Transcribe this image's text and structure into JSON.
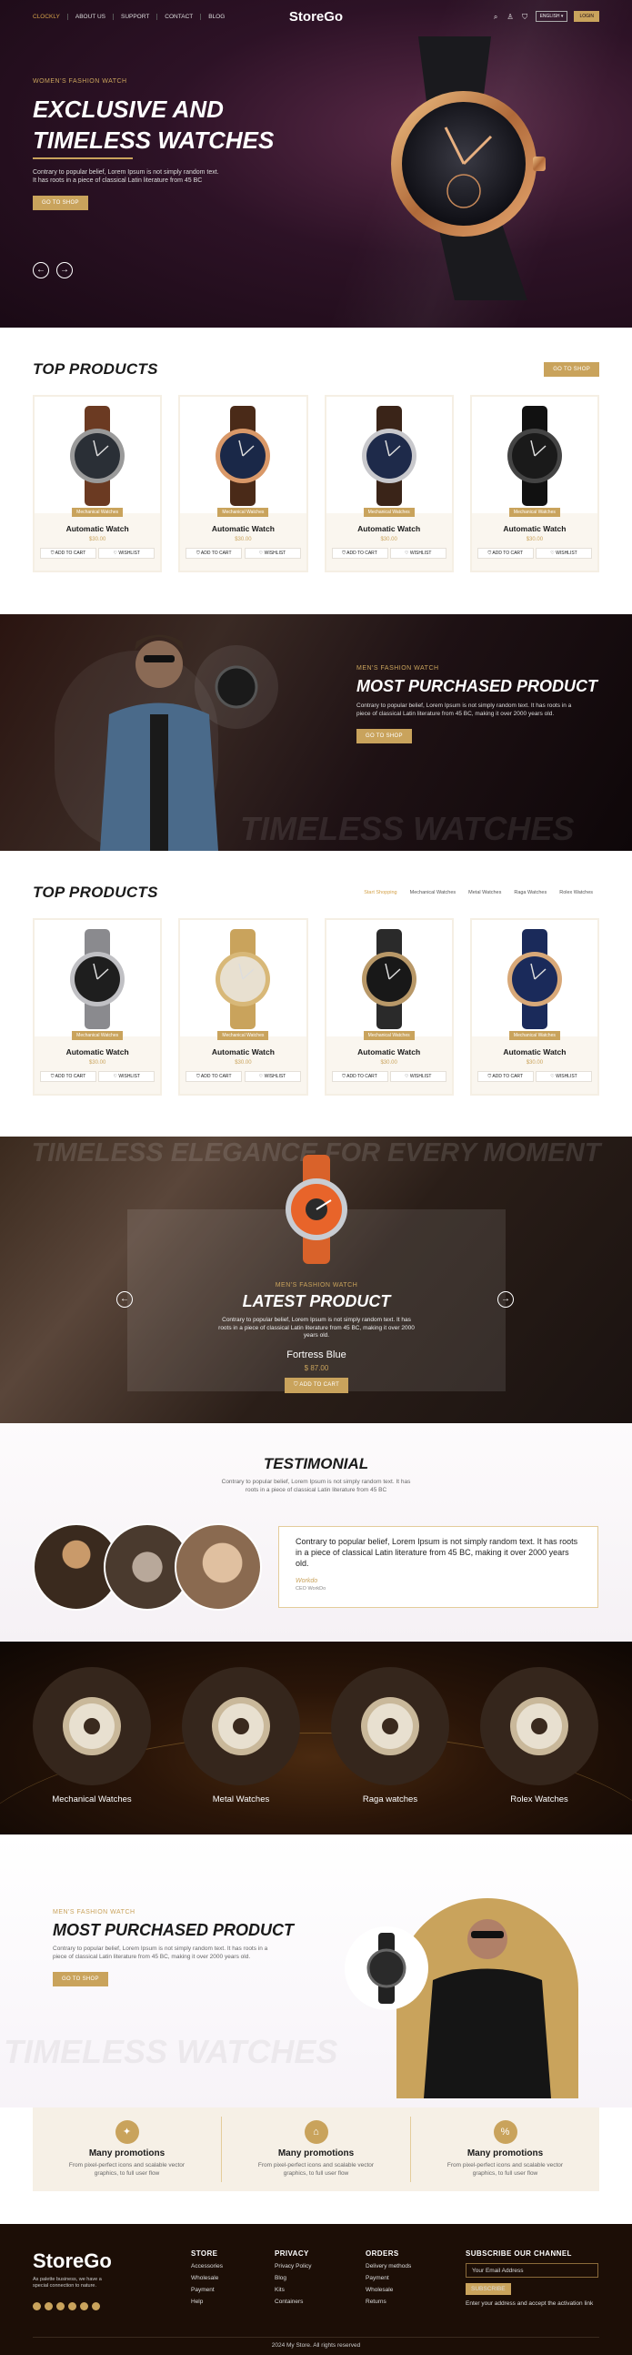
{
  "nav": {
    "links": [
      "CLOCKLY",
      "ABOUT US",
      "SUPPORT",
      "CONTACT",
      "BLOG"
    ],
    "brand": "StoreGo",
    "language": "ENGLISH ▾",
    "login": "LOGIN"
  },
  "hero": {
    "eyebrow": "WOMEN'S FASHION WATCH",
    "title_line1": "EXCLUSIVE AND",
    "title_line2": "TIMELESS WATCHES",
    "description": "Contrary to popular belief, Lorem Ipsum is not simply random text. It has roots in a piece of classical Latin literature from 45 BC",
    "button": "GO TO SHOP"
  },
  "top_products_1": {
    "title": "TOP PRODUCTS",
    "button": "GO TO SHOP",
    "products": [
      {
        "badge": "Mechanical Watches",
        "name": "Automatic Watch",
        "price": "$30.00",
        "add": "ADD TO CART",
        "wish": "WISHLIST"
      },
      {
        "badge": "Mechanical Watches",
        "name": "Automatic Watch",
        "price": "$30.00",
        "add": "ADD TO CART",
        "wish": "WISHLIST"
      },
      {
        "badge": "Mechanical Watches",
        "name": "Automatic Watch",
        "price": "$30.00",
        "add": "ADD TO CART",
        "wish": "WISHLIST"
      },
      {
        "badge": "Mechanical Watches",
        "name": "Automatic Watch",
        "price": "$30.00",
        "add": "ADD TO CART",
        "wish": "WISHLIST"
      }
    ]
  },
  "most_purchased_dark": {
    "eyebrow": "MEN'S FASHION WATCH",
    "title": "MOST PURCHASED PRODUCT",
    "description": "Contrary to popular belief, Lorem Ipsum is not simply random text. It has roots in a piece of classical Latin literature from 45 BC, making it over 2000 years old.",
    "button": "GO TO SHOP",
    "watermark": "TIMELESS WATCHES"
  },
  "top_products_2": {
    "title": "TOP PRODUCTS",
    "tabs": [
      "Start Shopping",
      "Mechanical Watches",
      "Metal Watches",
      "Raga Watches",
      "Rolex Watches"
    ],
    "products": [
      {
        "badge": "Mechanical Watches",
        "name": "Automatic Watch",
        "price": "$30.00",
        "add": "ADD TO CART",
        "wish": "WISHLIST"
      },
      {
        "badge": "Mechanical Watches",
        "name": "Automatic Watch",
        "price": "$30.00",
        "add": "ADD TO CART",
        "wish": "WISHLIST"
      },
      {
        "badge": "Mechanical Watches",
        "name": "Automatic Watch",
        "price": "$30.00",
        "add": "ADD TO CART",
        "wish": "WISHLIST"
      },
      {
        "badge": "Mechanical Watches",
        "name": "Automatic Watch",
        "price": "$30.00",
        "add": "ADD TO CART",
        "wish": "WISHLIST"
      }
    ]
  },
  "latest": {
    "watermark": "TIMELESS ELEGANCE FOR EVERY MOMENT",
    "eyebrow": "MEN'S FASHION WATCH",
    "title": "LATEST PRODUCT",
    "description": "Contrary to popular belief, Lorem Ipsum is not simply random text. It has roots in a piece of classical Latin literature from 45 BC, making it over 2000 years old.",
    "name": "Fortress Blue",
    "price": "$ 87.00",
    "button": "ADD TO CART"
  },
  "testimonial": {
    "title": "TESTIMONIAL",
    "subtitle": "Contrary to popular belief, Lorem Ipsum is not simply random text. It has roots in a piece of classical Latin literature from 45 BC",
    "quote": "Contrary to popular belief, Lorem Ipsum is not simply random text. It has roots in a piece of classical Latin literature from 45 BC, making it over 2000 years old.",
    "author": "Workdo",
    "role": "CEO WorkDo"
  },
  "categories": [
    {
      "label": "Mechanical Watches"
    },
    {
      "label": "Metal Watches"
    },
    {
      "label": "Raga watches"
    },
    {
      "label": "Rolex Watches"
    }
  ],
  "most_purchased_light": {
    "eyebrow": "MEN'S FASHION WATCH",
    "title": "MOST PURCHASED PRODUCT",
    "description": "Contrary to popular belief, Lorem Ipsum is not simply random text. It has roots in a piece of classical Latin literature from 45 BC, making it over 2000 years old.",
    "button": "GO TO SHOP",
    "watermark": "TIMELESS WATCHES"
  },
  "promotions": [
    {
      "title": "Many promotions",
      "description": "From pixel-perfect icons and scalable vector graphics, to full user flow"
    },
    {
      "title": "Many promotions",
      "description": "From pixel-perfect icons and scalable vector graphics, to full user flow"
    },
    {
      "title": "Many promotions",
      "description": "From pixel-perfect icons and scalable vector graphics, to full user flow"
    }
  ],
  "footer": {
    "brand": "StoreGo",
    "description": "As palette business, we have a special connection to nature.",
    "store": {
      "title": "STORE",
      "items": [
        "Accessories",
        "Wholesale",
        "Payment",
        "Help"
      ]
    },
    "privacy": {
      "title": "PRIVACY",
      "items": [
        "Privacy Policy",
        "Blog",
        "Kits",
        "Containers"
      ]
    },
    "orders": {
      "title": "ORDERS",
      "items": [
        "Delivery methods",
        "Payment",
        "Wholesale",
        "Returns"
      ]
    },
    "subscribe": {
      "title": "SUBSCRIBE OUR CHANNEL",
      "placeholder": "Your Email Address",
      "button": "SUBSCRIBE",
      "note": "Enter your address and accept the activation link"
    },
    "copyright": "2024 My Store. All rights reserved"
  },
  "colors": {
    "accent": "#c9a35c",
    "dark": "#1c0e06"
  }
}
